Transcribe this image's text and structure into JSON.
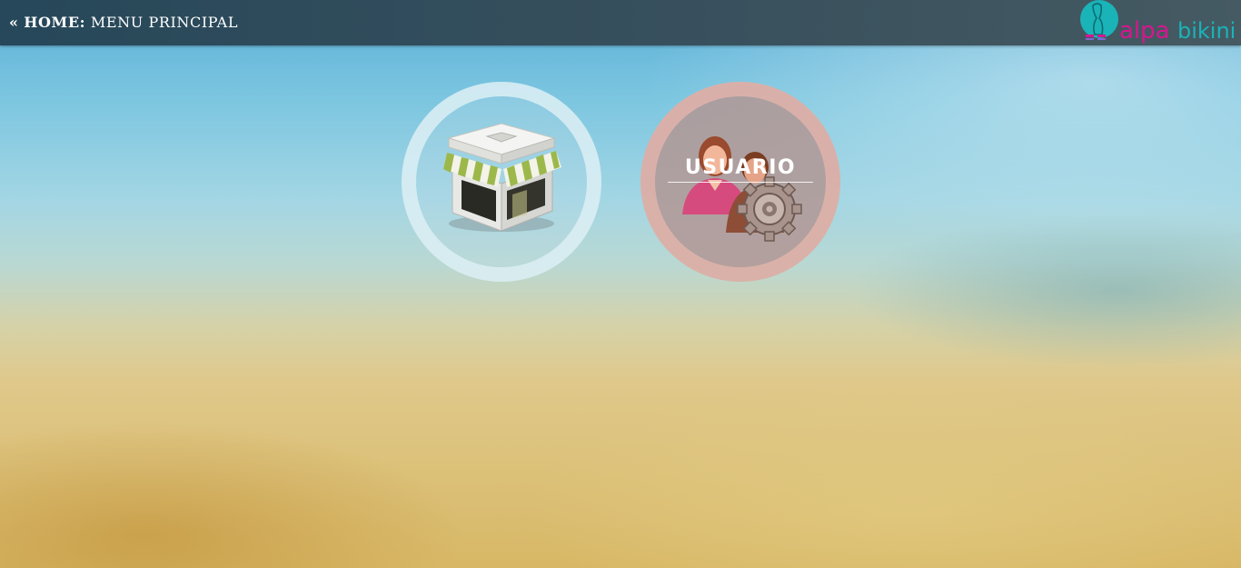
{
  "header": {
    "back_arrow": "«",
    "home_label": "HOME:",
    "page_label": "MENU PRINCIPAL",
    "logo_text": "alpa bikini"
  },
  "menu": {
    "items": [
      {
        "name": "tienda",
        "icon": "store-icon",
        "label": ""
      },
      {
        "name": "usuario",
        "icon": "users-gear-icon",
        "label": "USUARIO"
      }
    ]
  },
  "colors": {
    "header_bg": "#2f4b59",
    "logo_teal": "#1ab3b8",
    "logo_magenta": "#d6168f",
    "tienda_ring": "#dceef4",
    "usuario_ring": "#e1b4aa"
  }
}
